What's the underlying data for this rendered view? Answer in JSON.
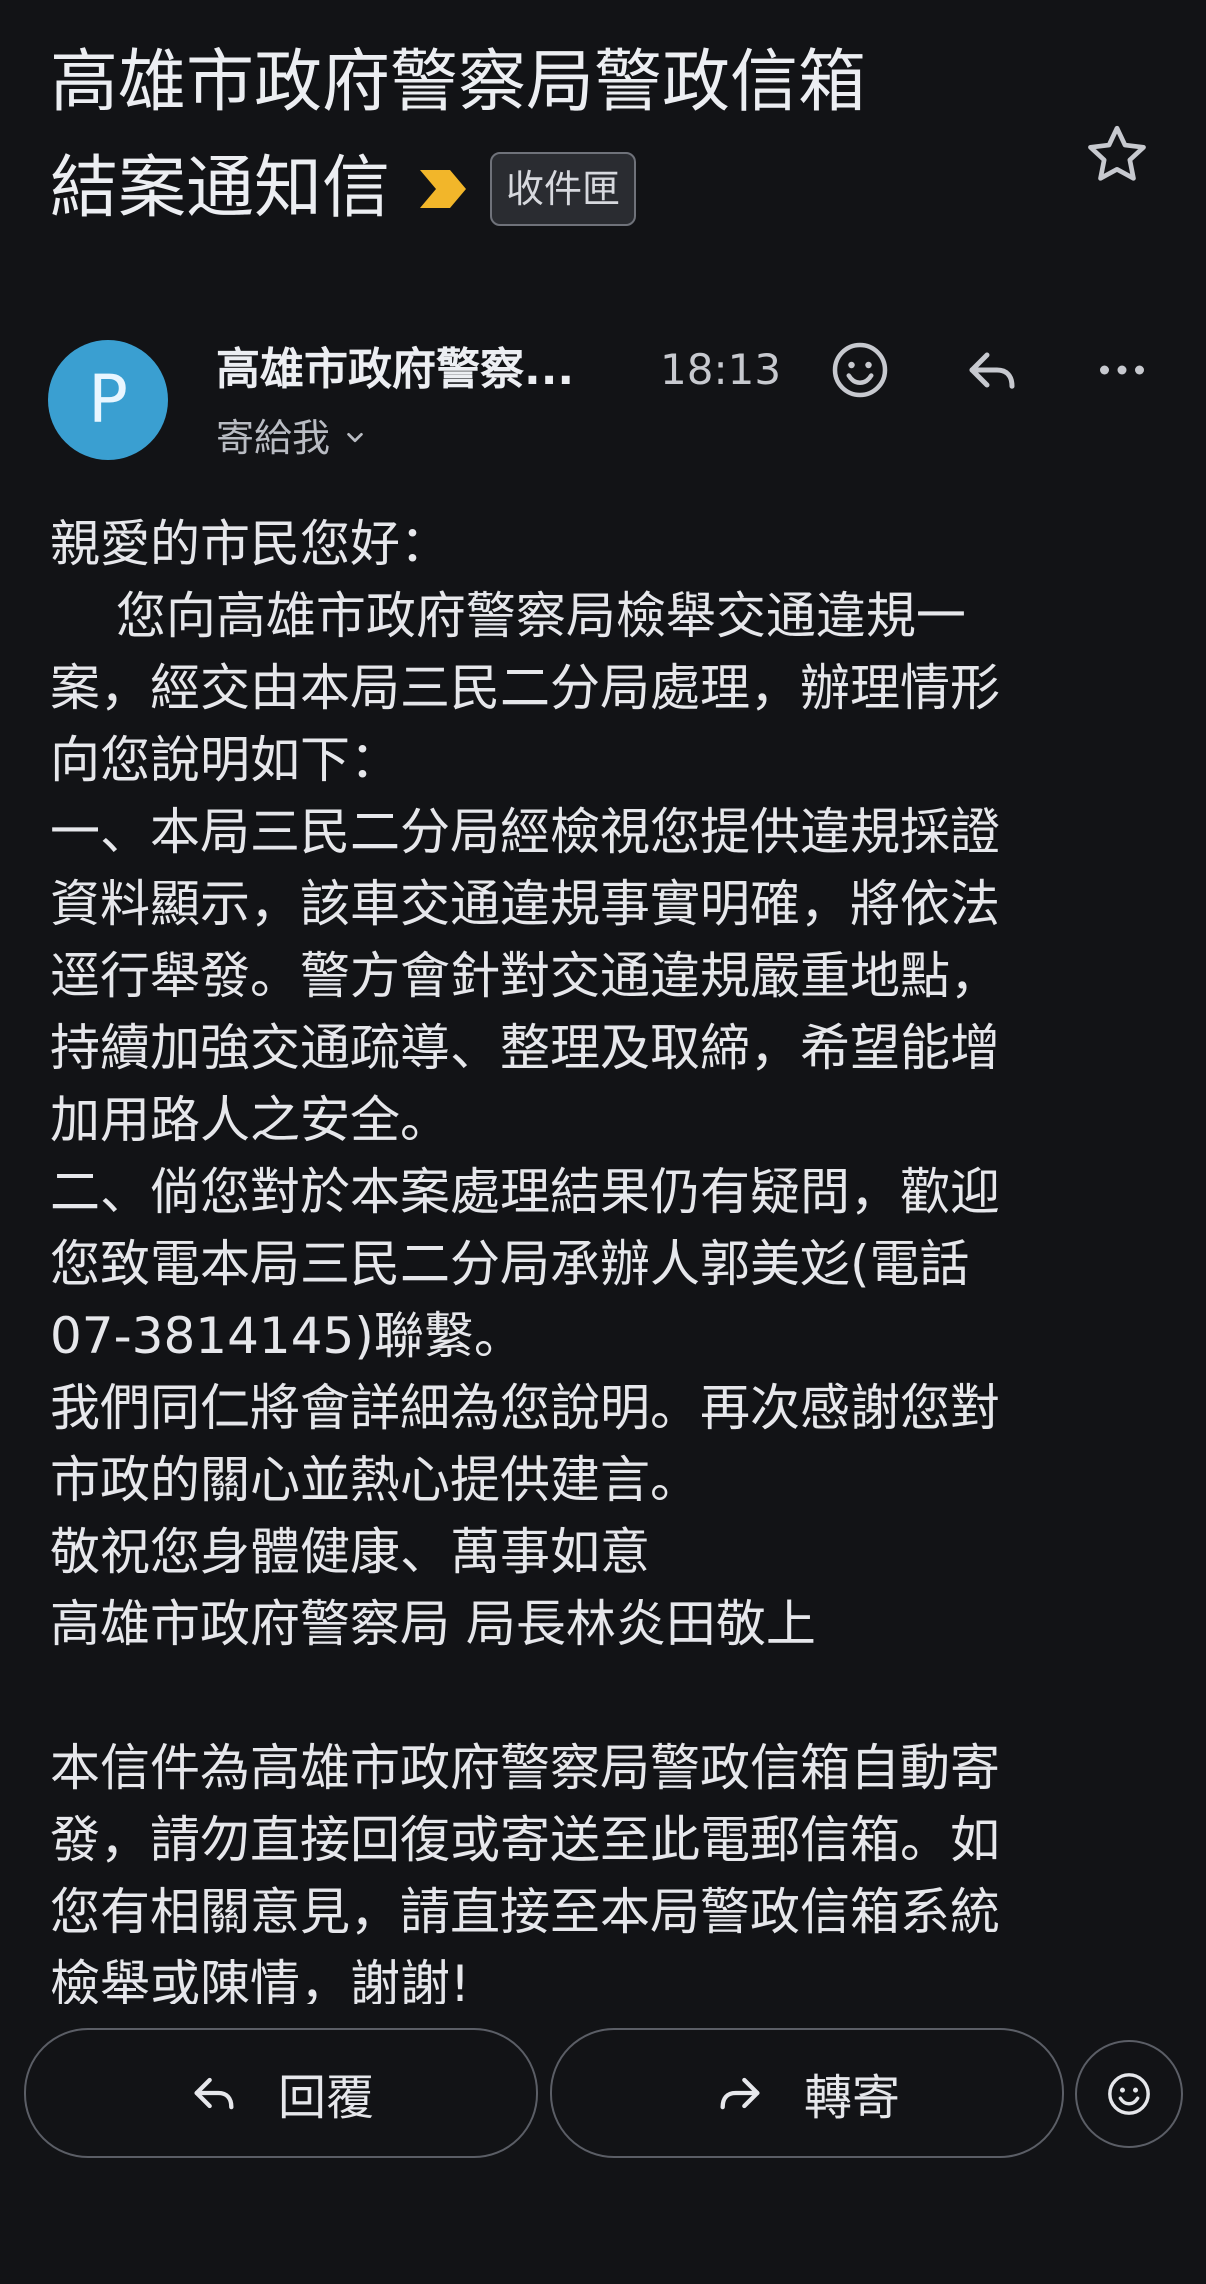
{
  "email": {
    "subject_line1": "高雄市政府警察局警政信箱",
    "subject_line2": "結案通知信",
    "label": "收件匣",
    "sender_initial": "P",
    "sender_name": "高雄市政府警察...",
    "time": "18:13",
    "recipient": "寄給我",
    "body_lines": [
      "親愛的市民您好：",
      "　 您向高雄市政府警察局檢舉交通違規一",
      "案，經交由本局三民二分局處理，辦理情形",
      "向您說明如下：",
      "一、本局三民二分局經檢視您提供違規採證",
      "資料顯示，該車交通違規事實明確，將依法",
      "逕行舉發。警方會針對交通違規嚴重地點，",
      "持續加強交通疏導、整理及取締，希望能增",
      "加用路人之安全。",
      "二、倘您對於本案處理結果仍有疑問，歡迎",
      "您致電本局三民二分局承辦人郭美彣(電話",
      "07-3814145)聯繫。",
      "我們同仁將會詳細為您說明。再次感謝您對",
      "市政的關心並熱心提供建言。",
      "敬祝您身體健康、萬事如意",
      "高雄市政府警察局 局長林炎田敬上",
      "",
      "本信件為高雄市政府警察局警政信箱自動寄",
      "發，請勿直接回復或寄送至此電郵信箱。如",
      "您有相關意見，請直接至本局警政信箱系統",
      "檢舉或陳情，謝謝!"
    ]
  },
  "actions": {
    "reply_label": "回覆",
    "forward_label": "轉寄"
  },
  "icons": {
    "star": "star-outline-icon",
    "importance": "importance-marker-icon",
    "emoji": "emoji-smile-icon",
    "reply": "reply-arrow-icon",
    "more": "more-horizontal-icon",
    "forward": "forward-arrow-icon",
    "chevron": "chevron-down-icon"
  },
  "colors": {
    "background": "#121316",
    "avatar": "#3a9fd1",
    "importance_marker": "#f2b62a",
    "text": "#e6e7eb"
  }
}
